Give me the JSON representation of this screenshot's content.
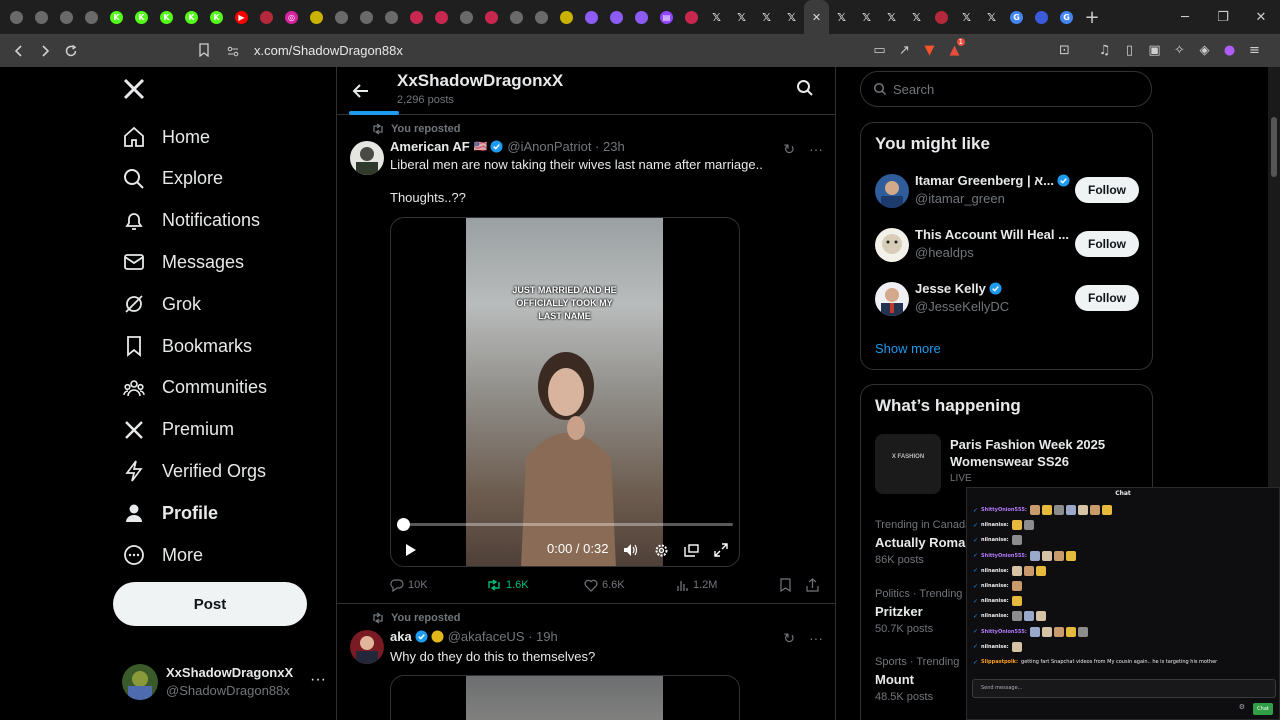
{
  "browser": {
    "url": "x.com/ShadowDragon88x",
    "new_tab_glyph": "+",
    "tab_favicons": [
      {
        "icon": "circle-icon",
        "color": "#6a6a6a",
        "glyph": ""
      },
      {
        "icon": "circle-icon",
        "color": "#6a6a6a",
        "glyph": ""
      },
      {
        "icon": "circle-icon",
        "color": "#6a6a6a",
        "glyph": ""
      },
      {
        "icon": "circle-icon",
        "color": "#6a6a6a",
        "glyph": ""
      },
      {
        "icon": "kick-icon",
        "color": "#53fc18",
        "glyph": "K"
      },
      {
        "icon": "kick-icon",
        "color": "#53fc18",
        "glyph": "K"
      },
      {
        "icon": "kick-icon",
        "color": "#53fc18",
        "glyph": "K"
      },
      {
        "icon": "kick-icon",
        "color": "#53fc18",
        "glyph": "K"
      },
      {
        "icon": "kick-icon",
        "color": "#53fc18",
        "glyph": "K"
      },
      {
        "icon": "youtube-icon",
        "color": "#ff0000",
        "glyph": "▶"
      },
      {
        "icon": "circle-icon",
        "color": "#b5283b",
        "glyph": ""
      },
      {
        "icon": "instagram-icon",
        "color": "#d6249f",
        "glyph": "◎"
      },
      {
        "icon": "circle-icon",
        "color": "#c9b200",
        "glyph": ""
      },
      {
        "icon": "circle-icon",
        "color": "#6a6a6a",
        "glyph": ""
      },
      {
        "icon": "circle-icon",
        "color": "#6a6a6a",
        "glyph": ""
      },
      {
        "icon": "circle-icon",
        "color": "#6a6a6a",
        "glyph": ""
      },
      {
        "icon": "circle-icon",
        "color": "#c8284f",
        "glyph": ""
      },
      {
        "icon": "circle-icon",
        "color": "#c8284f",
        "glyph": ""
      },
      {
        "icon": "circle-icon",
        "color": "#6a6a6a",
        "glyph": ""
      },
      {
        "icon": "circle-icon",
        "color": "#c8284f",
        "glyph": ""
      },
      {
        "icon": "circle-icon",
        "color": "#6a6a6a",
        "glyph": ""
      },
      {
        "icon": "circle-icon",
        "color": "#6a6a6a",
        "glyph": ""
      },
      {
        "icon": "circle-icon",
        "color": "#c9b200",
        "glyph": ""
      },
      {
        "icon": "circle-icon",
        "color": "#8d5cf6",
        "glyph": ""
      },
      {
        "icon": "circle-icon",
        "color": "#8d5cf6",
        "glyph": ""
      },
      {
        "icon": "circle-icon",
        "color": "#8d5cf6",
        "glyph": ""
      },
      {
        "icon": "twitch-icon",
        "color": "#9146ff",
        "glyph": "▤"
      },
      {
        "icon": "circle-icon",
        "color": "#c8284f",
        "glyph": ""
      },
      {
        "icon": "x-icon",
        "color": "#1f1f1f",
        "glyph": "𝕏"
      },
      {
        "icon": "x-icon",
        "color": "#1f1f1f",
        "glyph": "𝕏"
      },
      {
        "icon": "x-icon",
        "color": "#1f1f1f",
        "glyph": "𝕏"
      },
      {
        "icon": "x-icon",
        "color": "#1f1f1f",
        "glyph": "𝕏"
      },
      {
        "icon": "close-icon",
        "color": "#3c3c3c",
        "glyph": "✕"
      },
      {
        "icon": "x-icon",
        "color": "#1f1f1f",
        "glyph": "𝕏"
      },
      {
        "icon": "x-icon",
        "color": "#1f1f1f",
        "glyph": "𝕏"
      },
      {
        "icon": "x-icon",
        "color": "#1f1f1f",
        "glyph": "𝕏"
      },
      {
        "icon": "x-icon",
        "color": "#1f1f1f",
        "glyph": "𝕏"
      },
      {
        "icon": "circle-icon",
        "color": "#b5283b",
        "glyph": ""
      },
      {
        "icon": "x-icon",
        "color": "#1f1f1f",
        "glyph": "𝕏"
      },
      {
        "icon": "x-icon",
        "color": "#1f1f1f",
        "glyph": "𝕏"
      },
      {
        "icon": "google-icon",
        "color": "#4285f4",
        "glyph": "G"
      },
      {
        "icon": "circle-icon",
        "color": "#3b5bdb",
        "glyph": ""
      },
      {
        "icon": "google-icon",
        "color": "#4285f4",
        "glyph": "G"
      }
    ],
    "notification_count": "1"
  },
  "sidebar": {
    "items": [
      {
        "label": "Home",
        "icon": "home-icon"
      },
      {
        "label": "Explore",
        "icon": "search-icon"
      },
      {
        "label": "Notifications",
        "icon": "bell-icon"
      },
      {
        "label": "Messages",
        "icon": "mail-icon"
      },
      {
        "label": "Grok",
        "icon": "grok-icon"
      },
      {
        "label": "Bookmarks",
        "icon": "bookmark-icon"
      },
      {
        "label": "Communities",
        "icon": "communities-icon"
      },
      {
        "label": "Premium",
        "icon": "x-premium-icon"
      },
      {
        "label": "Verified Orgs",
        "icon": "lightning-icon"
      },
      {
        "label": "Profile",
        "icon": "person-icon"
      },
      {
        "label": "More",
        "icon": "more-circle-icon"
      }
    ],
    "post_label": "Post",
    "account": {
      "name": "XxShadowDragonxX",
      "handle": "@ShadowDragon88x",
      "more": "···"
    }
  },
  "header": {
    "title": "XxShadowDragonxX",
    "posts_count": "2,296 posts"
  },
  "posts": [
    {
      "reposted": "You reposted",
      "name": "American AF",
      "flag": "🇺🇸",
      "handle_time": "@iAnonPatriot · 23h",
      "text_line1": "Liberal men are now taking their wives last name after marriage..",
      "text_line2": "Thoughts..??",
      "video_caption": "JUST MARRIED AND HE OFFICIALLY TOOK MY LAST NAME",
      "video_time": "0:00 / 0:32",
      "video_progress": 0,
      "stats": {
        "replies": "10K",
        "reposts": "1.6K",
        "likes": "6.6K",
        "views": "1.2M"
      }
    },
    {
      "reposted": "You reposted",
      "name": "aka",
      "handle_time": "@akafaceUS · 19h",
      "text_line1": "Why do they do this to themselves?"
    }
  ],
  "right": {
    "search_placeholder": "Search",
    "might_like_title": "You might like",
    "suggestions": [
      {
        "name": "Itamar Greenberg | א...",
        "handle": "@itamar_green",
        "verified": true
      },
      {
        "name": "This Account Will Heal ...",
        "handle": "@healdps",
        "verified": false
      },
      {
        "name": "Jesse Kelly",
        "handle": "@JesseKellyDC",
        "verified": true
      }
    ],
    "follow_label": "Follow",
    "show_more": "Show more",
    "happening_title": "What’s happening",
    "featured": {
      "title": "Paris Fashion Week 2025 Womenswear SS26",
      "status": "LIVE",
      "thumb_text": "X FASHION"
    },
    "trends": [
      {
        "meta": "Trending in Canada",
        "name": "Actually Romar",
        "count": "86K posts"
      },
      {
        "meta": "Politics · Trending",
        "name": "Pritzker",
        "count": "50.7K posts"
      },
      {
        "meta": "Sports · Trending",
        "name": "Mount",
        "count": "48.5K posts"
      }
    ]
  },
  "chat": {
    "title": "Chat",
    "messages": [
      {
        "user": "ShittyOnion555:",
        "color": "#b57cff",
        "text": "",
        "emotes": 7
      },
      {
        "user": "nilnanise:",
        "color": "#efeff1",
        "text": "",
        "emotes": 2
      },
      {
        "user": "nilnanise:",
        "color": "#efeff1",
        "text": "",
        "emotes": 1
      },
      {
        "user": "ShittyOnion555:",
        "color": "#b57cff",
        "text": "",
        "emotes": 4
      },
      {
        "user": "nilnanise:",
        "color": "#efeff1",
        "text": "",
        "emotes": 3
      },
      {
        "user": "nilnanise:",
        "color": "#efeff1",
        "text": "",
        "emotes": 1
      },
      {
        "user": "nilnanise:",
        "color": "#efeff1",
        "text": "",
        "emotes": 1
      },
      {
        "user": "nilnanise:",
        "color": "#efeff1",
        "text": "",
        "emotes": 3
      },
      {
        "user": "ShittyOnion555:",
        "color": "#b57cff",
        "text": "",
        "emotes": 5
      },
      {
        "user": "nilnanise:",
        "color": "#efeff1",
        "text": "",
        "emotes": 1
      },
      {
        "user": "Slippastpolk:",
        "color": "#ff9f1a",
        "text": "getting fart Snapchat videos from My cousin again.. he is targeting his mother",
        "emotes": 0
      }
    ],
    "input_placeholder": "Send message...",
    "send_label": "Chat"
  }
}
